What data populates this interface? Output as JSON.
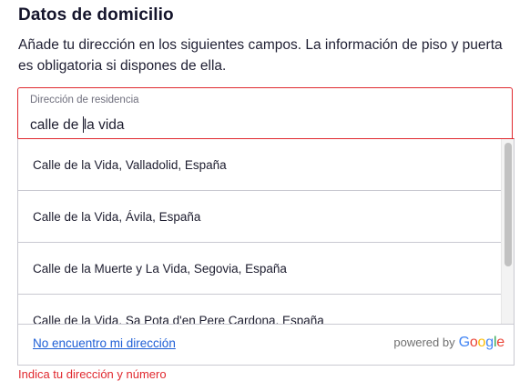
{
  "section": {
    "title": "Datos de domicilio",
    "description": "Añade tu dirección en los siguientes campos. La información de piso y puerta es obligatoria si dispones de ella."
  },
  "address_field": {
    "label": "Dirección de residencia",
    "value_before_caret": "calle de ",
    "value_after_caret": "la vida"
  },
  "suggestions": [
    "Calle de la Vida, Valladolid, España",
    "Calle de la Vida, Ávila, España",
    "Calle de la Muerte y La Vida, Segovia, España",
    "Calle de la Vida, Sa Pota d'en Pere Cardona, España"
  ],
  "dropdown_footer": {
    "not_found_link": "No encuentro mi dirección",
    "powered_by": "powered by",
    "google": [
      "G",
      "o",
      "o",
      "g",
      "l",
      "e"
    ]
  },
  "error": {
    "text": "Indica tu dirección y número"
  },
  "colors": {
    "error": "#e0282e",
    "link": "#1f5fd6"
  }
}
